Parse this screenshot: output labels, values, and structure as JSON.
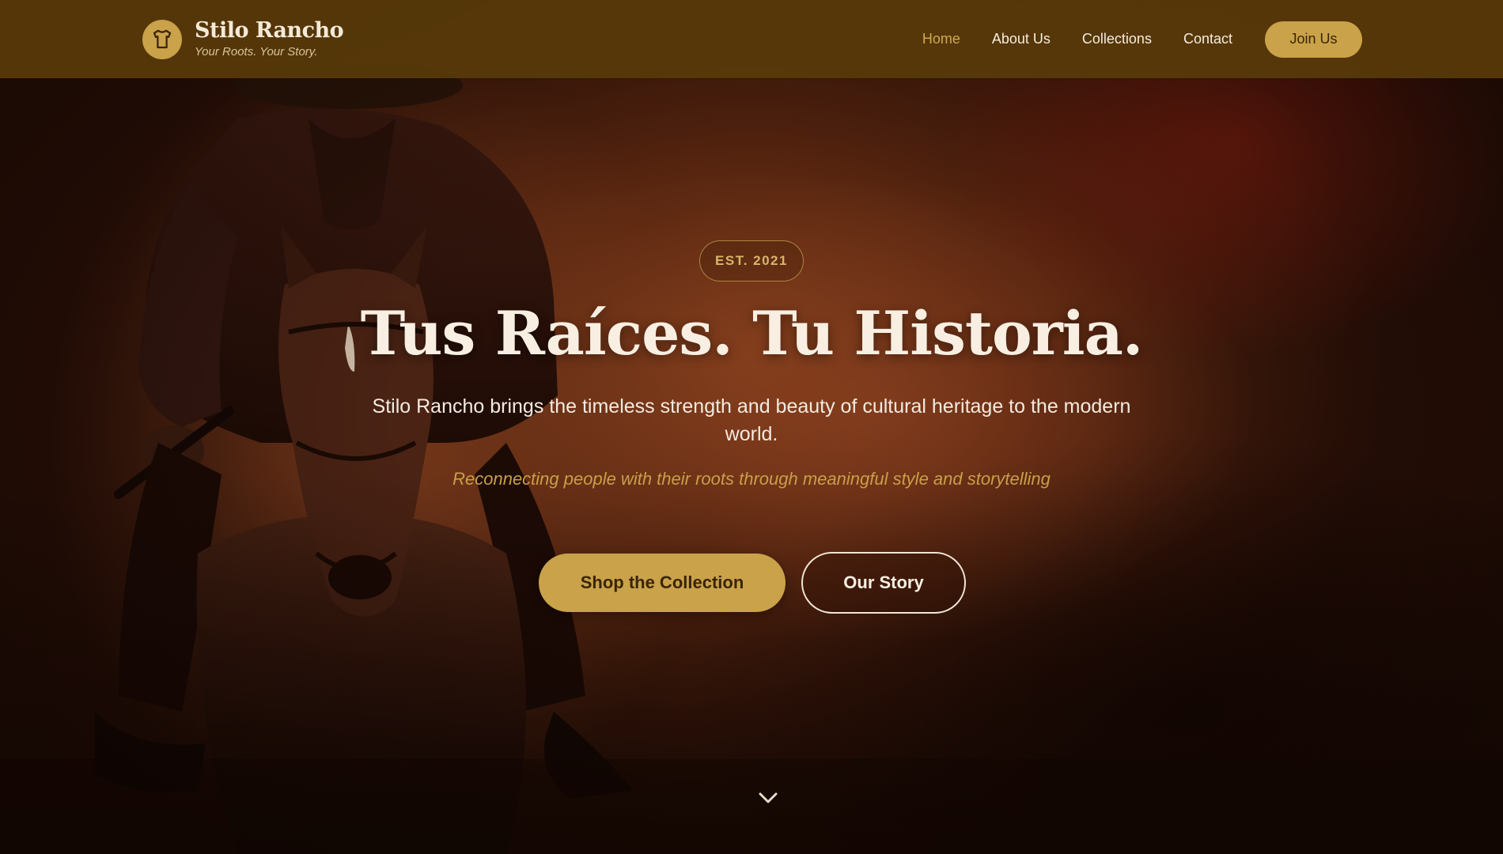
{
  "brand": {
    "name": "Stilo Rancho",
    "tagline": "Your Roots. Your Story.",
    "logo_icon": "shirt-icon"
  },
  "nav": {
    "items": [
      {
        "label": "Home",
        "active": true
      },
      {
        "label": "About Us",
        "active": false
      },
      {
        "label": "Collections",
        "active": false
      },
      {
        "label": "Contact",
        "active": false
      }
    ],
    "cta_label": "Join Us"
  },
  "hero": {
    "badge": "EST. 2021",
    "headline": "Tus Raíces. Tu Historia.",
    "subtitle": "Stilo Rancho brings the timeless strength and beauty of cultural heritage to the modern world.",
    "tagline": "Reconnecting people with their roots through meaningful style and storytelling",
    "primary_button": "Shop the Collection",
    "secondary_button": "Our Story",
    "scroll_icon": "chevron-down-icon",
    "background_image": "cowboy riding horse through dust"
  },
  "colors": {
    "accent_gold": "#c9a24a",
    "nav_background": "#583a0a",
    "headline_text": "#f8efe2",
    "tagline_gold": "#c99f48"
  }
}
